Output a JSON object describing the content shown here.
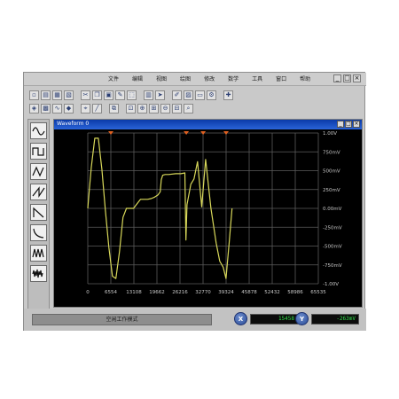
{
  "menu": {
    "items": [
      "文件",
      "编辑",
      "视图",
      "绘图",
      "修改",
      "数学",
      "工具",
      "窗口",
      "帮助"
    ],
    "window_controls": [
      "_",
      "□",
      "×"
    ]
  },
  "toolbar": {
    "row1_icons": [
      "new-file-icon",
      "open-icon",
      "save-icon",
      "print-icon",
      "cut-icon",
      "copy-icon",
      "paste-icon",
      "draw-icon",
      "select-icon",
      "grid-icon",
      "cursor-icon",
      "erase-icon",
      "chart-icon",
      "monitor-icon",
      "settings-icon",
      "apply-icon"
    ],
    "row2_icons": [
      "probe-icon",
      "measure-icon",
      "wave-icon",
      "marker-icon",
      "ruler-icon",
      "line-tool-icon",
      "copy-wave-icon",
      "zoom-fit-icon",
      "zoom-in-icon",
      "zoom-in-x-icon",
      "zoom-out-icon",
      "zoom-out-x-icon",
      "zoom-custom-icon"
    ]
  },
  "sidebar": {
    "icons": [
      "sine-wave-icon",
      "square-wave-icon",
      "triangle-wave-icon",
      "sawtooth-wave-icon",
      "ramp-wave-icon",
      "exp-decay-icon",
      "pulse-wave-icon",
      "noise-wave-icon"
    ]
  },
  "child_window": {
    "title": "Waveform 0",
    "controls": [
      "_",
      "□",
      "×"
    ]
  },
  "chart_data": {
    "type": "line",
    "title": "",
    "xlabel": "",
    "ylabel": "",
    "x_ticks": [
      "0",
      "6554",
      "13108",
      "19662",
      "26216",
      "32770",
      "39324",
      "45878",
      "52432",
      "58986",
      "65535"
    ],
    "y_ticks": [
      "1.00V",
      "750mV",
      "500mV",
      "250mV",
      "0.00mV",
      "-250mV",
      "-500mV",
      "-750mV",
      "-1.00V"
    ],
    "xlim": [
      0,
      65535
    ],
    "ylim": [
      -1.0,
      1.0
    ],
    "grid": true,
    "line_color": "#d8d85a",
    "background": "#000000",
    "grid_color": "#5c5c5c",
    "marker_color": "#e06020",
    "markers_x": [
      6554,
      28000,
      32800,
      39324
    ],
    "series": [
      {
        "x": [
          0,
          400,
          1000,
          2000,
          3000,
          4000,
          5000,
          6000,
          7000,
          8000,
          9000,
          10000,
          11000,
          12000,
          13000,
          14000,
          15000,
          16000,
          17000,
          18000,
          19000,
          20000,
          20600,
          20900,
          21300,
          22000,
          23000,
          25000,
          26500,
          27600,
          27900,
          28200,
          29300,
          30200,
          31200,
          32400,
          33500,
          35000,
          36500,
          37500,
          38500,
          39300,
          40200,
          41000
        ],
        "y": [
          0.0,
          0.23,
          0.55,
          0.93,
          0.93,
          0.52,
          -0.02,
          -0.52,
          -0.9,
          -0.93,
          -0.58,
          -0.12,
          0.0,
          0.0,
          0.0,
          0.06,
          0.12,
          0.12,
          0.12,
          0.13,
          0.15,
          0.18,
          0.22,
          0.38,
          0.44,
          0.45,
          0.45,
          0.46,
          0.46,
          0.47,
          -0.42,
          0.05,
          0.32,
          0.39,
          0.62,
          0.02,
          0.65,
          0.0,
          -0.46,
          -0.7,
          -0.78,
          -0.93,
          -0.45,
          0.0
        ]
      }
    ]
  },
  "status": {
    "mode_text": "空闲工作模式",
    "x_label": "X",
    "x_value": "15458",
    "y_label": "Y",
    "y_value": "-263mV"
  }
}
